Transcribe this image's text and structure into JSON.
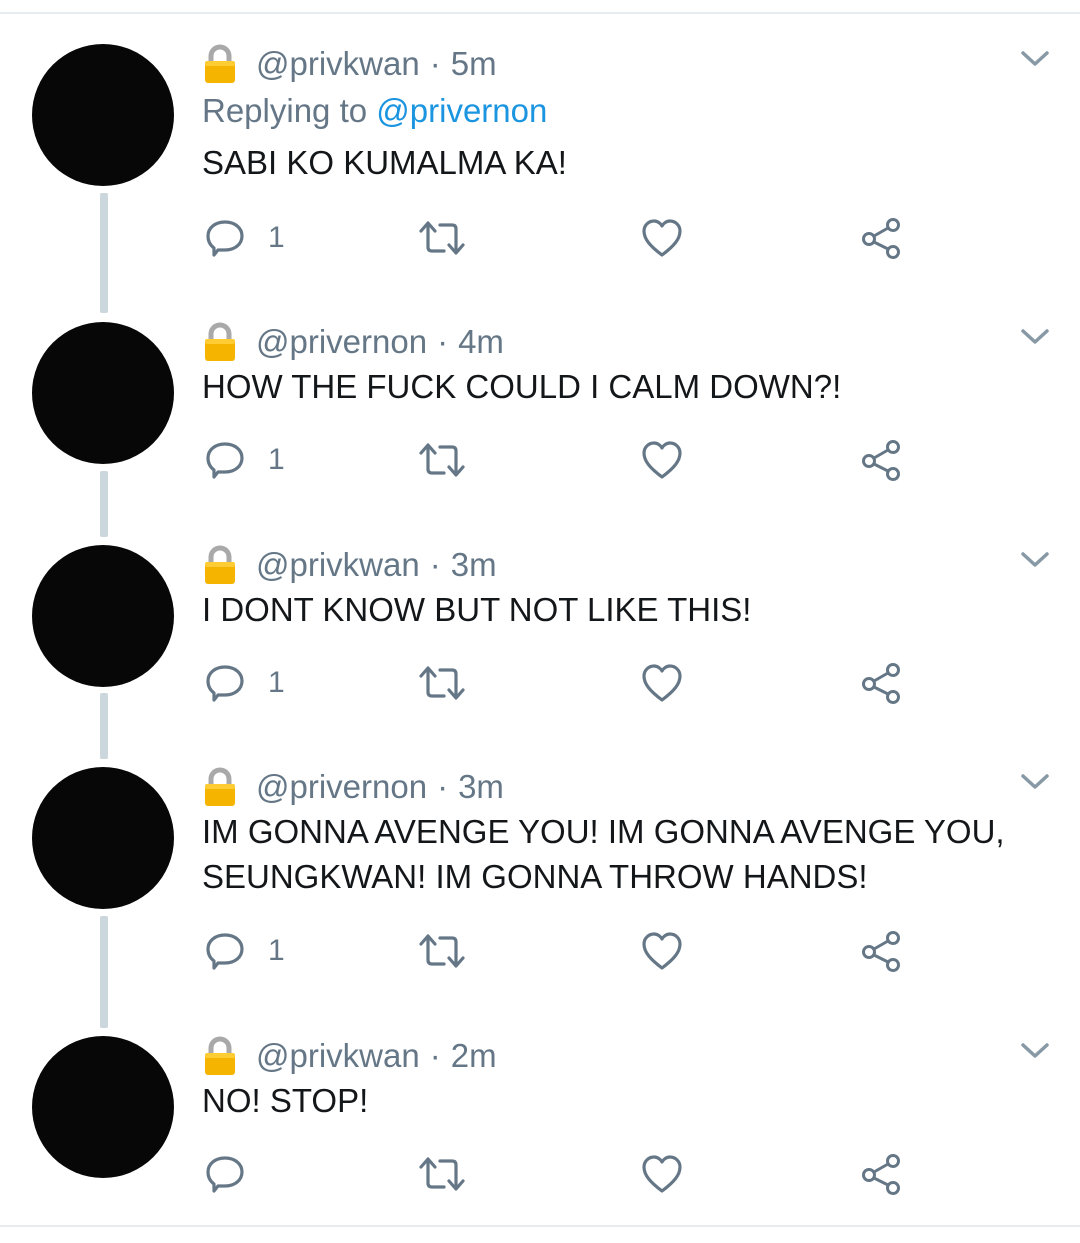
{
  "colors": {
    "text_primary": "#14171a",
    "text_secondary": "#657786",
    "mention": "#1b95e0",
    "thread_line": "#ccd6dd",
    "avatar": "#070707",
    "lock_body": "#f5b400",
    "lock_shackle": "#a9a9a9"
  },
  "icons": {
    "lock": "lock-icon",
    "caret": "chevron-down-icon",
    "reply": "reply-icon",
    "retweet": "retweet-icon",
    "like": "heart-icon",
    "share": "share-icon"
  },
  "tweets": [
    {
      "handle": "@privkwan",
      "separator": "·",
      "time": "5m",
      "replying_label": "Replying to",
      "replying_to": "@privernon",
      "text": "SABI KO KUMALMA KA!",
      "reply_count": "1"
    },
    {
      "handle": "@privernon",
      "separator": "·",
      "time": "4m",
      "text": "HOW THE FUCK COULD I CALM DOWN?!",
      "reply_count": "1"
    },
    {
      "handle": "@privkwan",
      "separator": "·",
      "time": "3m",
      "text": "I DONT KNOW BUT NOT LIKE THIS!",
      "reply_count": "1"
    },
    {
      "handle": "@privernon",
      "separator": "·",
      "time": "3m",
      "text": "IM GONNA AVENGE YOU! IM GONNA AVENGE YOU, SEUNGKWAN! IM GONNA THROW HANDS!",
      "reply_count": "1"
    },
    {
      "handle": "@privkwan",
      "separator": "·",
      "time": "2m",
      "text": "NO! STOP!",
      "reply_count": ""
    }
  ]
}
